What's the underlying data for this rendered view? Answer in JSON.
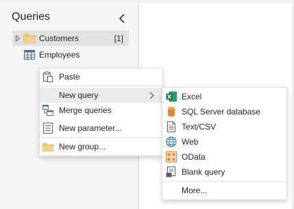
{
  "pane": {
    "title": "Queries",
    "items": [
      {
        "label": "Customers",
        "count": "[1]",
        "icon": "folder-icon",
        "expander": "expand-triangle-icon"
      },
      {
        "label": "Employees",
        "icon": "table-icon"
      }
    ]
  },
  "context_menu": {
    "items": [
      {
        "label": "Paste",
        "icon": "paste-icon"
      },
      {
        "label": "New query",
        "icon": "",
        "has_submenu": true
      },
      {
        "label": "Merge queries",
        "icon": "merge-queries-icon"
      },
      {
        "label": "New parameter...",
        "icon": "parameter-icon"
      },
      {
        "label": "New group...",
        "icon": "folder-icon"
      }
    ]
  },
  "new_query_submenu": {
    "items": [
      {
        "label": "Excel",
        "icon": "excel-icon"
      },
      {
        "label": "SQL Server database",
        "icon": "database-icon"
      },
      {
        "label": "Text/CSV",
        "icon": "document-icon"
      },
      {
        "label": "Web",
        "icon": "globe-icon"
      },
      {
        "label": "OData",
        "icon": "odata-icon"
      },
      {
        "label": "Blank query",
        "icon": "blank-query-icon"
      },
      {
        "label": "More..."
      }
    ]
  },
  "colors": {
    "pane_background": "#f5f5f5",
    "selected_row": "#e1e1e1",
    "menu_hover": "#ebebeb",
    "folder": "#f2c66c",
    "excel_green": "#1d6f42",
    "odata_orange": "#e8862a",
    "web_blue": "#3d7cc9"
  }
}
